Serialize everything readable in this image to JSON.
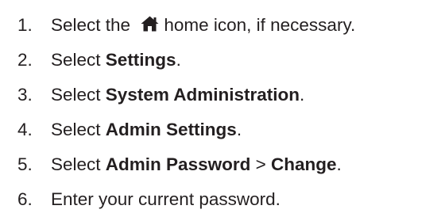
{
  "steps": [
    {
      "number": "1.",
      "parts": [
        "Select the ",
        "home icon, if necessary."
      ],
      "icon": "home-icon"
    },
    {
      "number": "2.",
      "prefix": "Select ",
      "bold": "Settings",
      "suffix": "."
    },
    {
      "number": "3.",
      "prefix": "Select ",
      "bold": "System Administration",
      "suffix": "."
    },
    {
      "number": "4.",
      "prefix": "Select ",
      "bold": "Admin Settings",
      "suffix": "."
    },
    {
      "number": "5.",
      "prefix": "Select ",
      "bold": "Admin Password",
      "middle": " > ",
      "bold2": "Change",
      "suffix": "."
    },
    {
      "number": "6.",
      "text": "Enter your current password."
    }
  ],
  "colors": {
    "text": "#231f20"
  }
}
